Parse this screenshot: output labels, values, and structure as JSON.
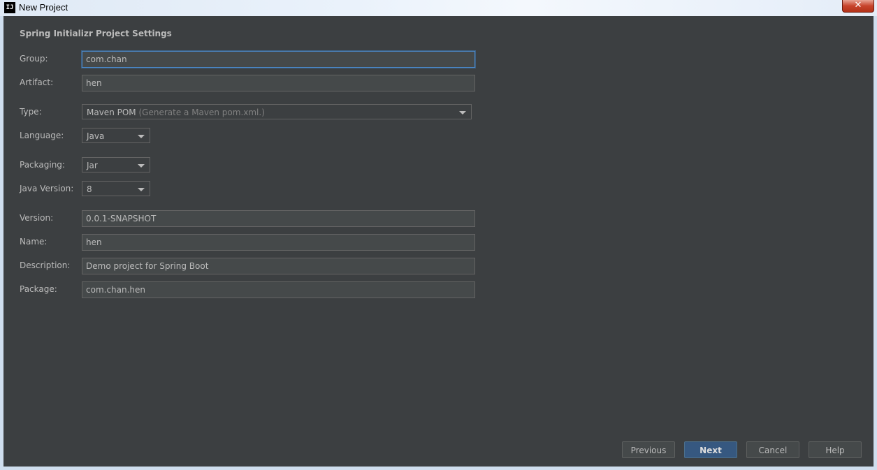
{
  "window": {
    "title": "New Project",
    "app_icon": "IJ",
    "close_glyph": "✕"
  },
  "section_title": "Spring Initializr Project Settings",
  "form": {
    "group": {
      "label": "Group:",
      "value": "com.chan"
    },
    "artifact": {
      "label": "Artifact:",
      "value": "hen"
    },
    "type": {
      "label": "Type:",
      "value": "Maven POM",
      "hint": "(Generate a Maven pom.xml.)"
    },
    "language": {
      "label": "Language:",
      "value": "Java"
    },
    "packaging": {
      "label": "Packaging:",
      "value": "Jar"
    },
    "java_version": {
      "label": "Java Version:",
      "value": "8"
    },
    "version": {
      "label": "Version:",
      "value": "0.0.1-SNAPSHOT"
    },
    "name": {
      "label": "Name:",
      "value": "hen"
    },
    "description": {
      "label": "Description:",
      "value": "Demo project for Spring Boot"
    },
    "package": {
      "label": "Package:",
      "value": "com.chan.hen"
    }
  },
  "buttons": {
    "previous": "Previous",
    "next": "Next",
    "cancel": "Cancel",
    "help": "Help"
  },
  "colors": {
    "background": "#3c3f41",
    "field_bg": "#45494a",
    "text": "#bbbbbb",
    "primary_button": "#365880",
    "focus": "#4b89c9"
  }
}
